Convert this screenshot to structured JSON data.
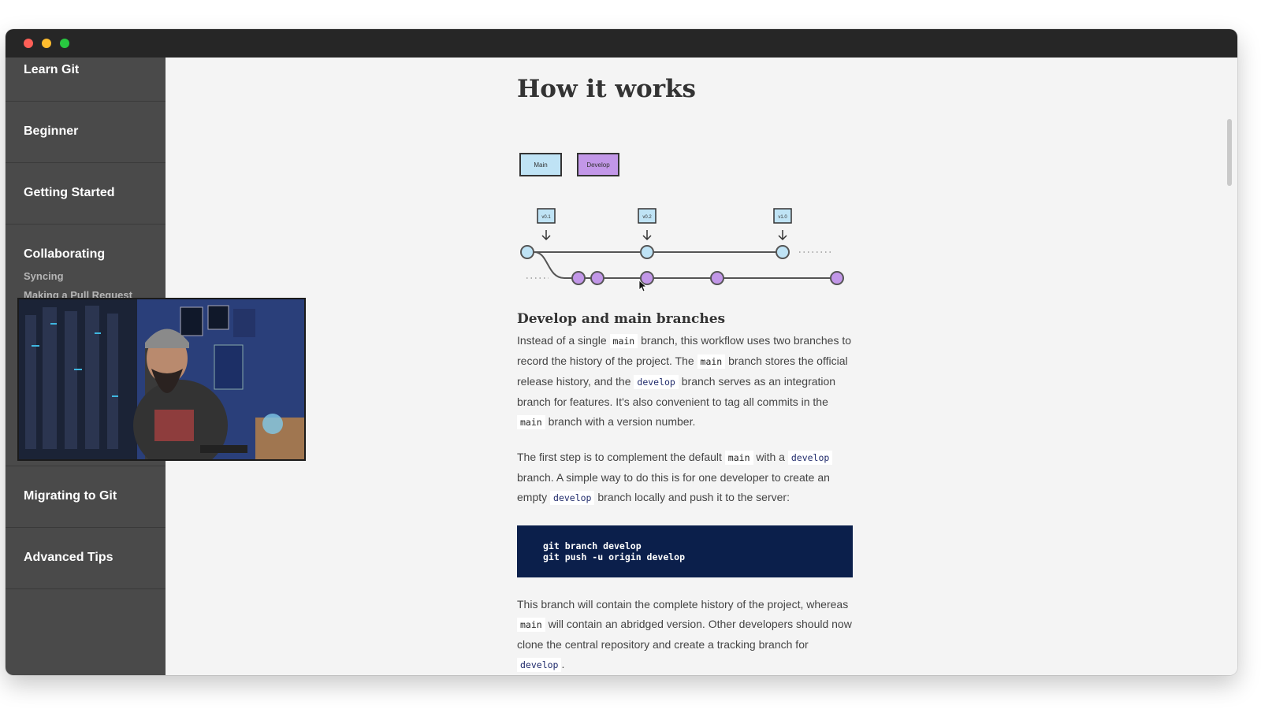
{
  "sidebar": {
    "items": [
      {
        "label": "Learn Git"
      },
      {
        "label": "Beginner"
      },
      {
        "label": "Getting Started"
      },
      {
        "label": "Collaborating",
        "subitems": [
          "Syncing",
          "Making a Pull Request"
        ]
      },
      {
        "label": "Migrating to Git"
      },
      {
        "label": "Advanced Tips"
      }
    ]
  },
  "article": {
    "title": "How it works",
    "legend": {
      "main": "Main",
      "develop": "Develop"
    },
    "diagram": {
      "tags": [
        "v0.1",
        "v0.2",
        "v1.0"
      ],
      "main_color": "#bfe3f5",
      "develop_color": "#c297e8"
    },
    "section_title": "Develop and main branches",
    "p1": {
      "t1": "Instead of a single ",
      "c1": "main",
      "t2": " branch, this workflow uses two branches to record the history of the project. The ",
      "c2": "main",
      "t3": " branch stores the official release history, and the ",
      "c3": "develop",
      "t4": " branch serves as an integration branch for features. It's also convenient to tag all commits in the ",
      "c4": "main",
      "t5": " branch with a version number."
    },
    "p2": {
      "t1": "The first step is to complement the default ",
      "c1": "main",
      "t2": " with a ",
      "c2": "develop",
      "t3": " branch. A simple way to do this is for one developer to create an empty ",
      "c3": "develop",
      "t4": " branch locally and push it to the server:"
    },
    "code": {
      "line1": "git branch develop",
      "line2": "git push -u origin develop"
    },
    "p3": {
      "t1": "This branch will contain the complete history of the project, whereas ",
      "c1": "main",
      "t2": " will contain an abridged version. Other developers should now clone the central repository and create a tracking branch for ",
      "c2": "develop",
      "t3": "."
    }
  },
  "colors": {
    "sidebar_bg": "#4a4a4a",
    "content_bg": "#f4f4f4",
    "code_bg": "#0b1f4b",
    "titlebar_bg": "#262626"
  }
}
